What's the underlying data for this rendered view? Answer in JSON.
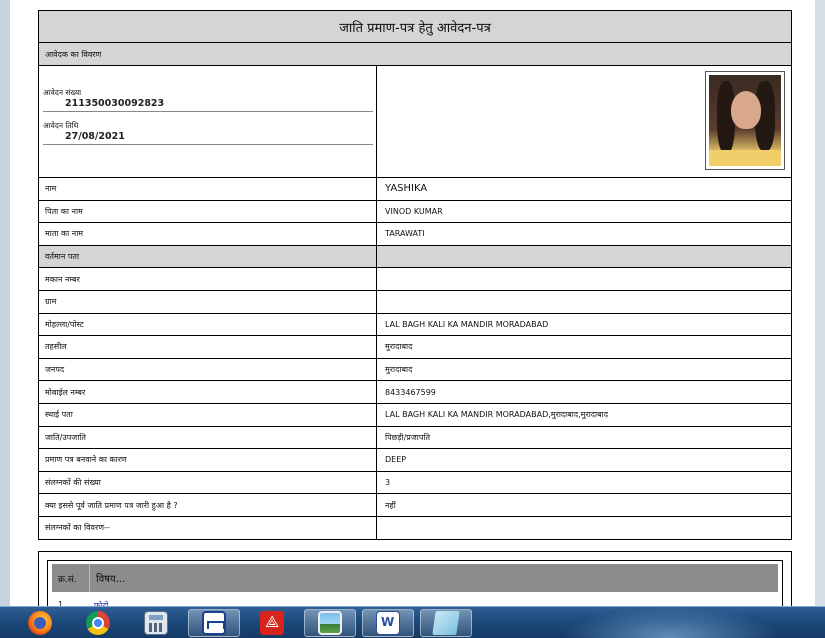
{
  "form": {
    "title": "जाति प्रमाण-पत्र हेतु आवेदन-पत्र",
    "applicant_section": "आवेदक का विवरण",
    "application_number_label": "आवेदन संख्या",
    "application_number": "211350030092823",
    "application_date_label": "आवेदन तिथि",
    "application_date": "27/08/2021",
    "rows": [
      {
        "label": "नाम",
        "value": "YASHIKA"
      },
      {
        "label": "पिता का नाम",
        "value": "VINOD KUMAR"
      },
      {
        "label": "माता का नाम",
        "value": "TARAWATI"
      },
      {
        "label": "वर्तमान पता",
        "value": ""
      },
      {
        "label": "मकान नम्बर",
        "value": ""
      },
      {
        "label": "ग्राम",
        "value": ""
      },
      {
        "label": "मोहल्ला/पोस्ट",
        "value": "LAL BAGH KALI KA MANDIR MORADABAD"
      },
      {
        "label": "तहसील",
        "value": "मुरादाबाद"
      },
      {
        "label": "जनपद",
        "value": "मुरादाबाद"
      },
      {
        "label": "मोबाईल नम्बर",
        "value": "8433467599"
      },
      {
        "label": "स्थाई पता",
        "value": "LAL BAGH KALI KA MANDIR MORADABAD,मुरादाबाद,मुरादाबाद"
      },
      {
        "label": "जाति/उपजाति",
        "value": "पिछड़ी/प्रजापति"
      },
      {
        "label": "प्रमाण पत्र बनवाने का कारण",
        "value": "DEEP"
      },
      {
        "label": "संलग्नकों की संख्या",
        "value": "3"
      },
      {
        "label": "क्या इससे पूर्व जाति प्रमाण पत्र जारी हुआ है ?",
        "value": "नहीं"
      },
      {
        "label": "संलग्नकों का विवरण--",
        "value": ""
      }
    ],
    "attachments": {
      "col_sno": "क्र.सं.",
      "col_subject": "विषय...",
      "first_sno": "1",
      "first_subject": "फोटो"
    }
  },
  "taskbar": {
    "apps": [
      "firefox-icon",
      "chrome-icon",
      "calculator-icon",
      "scanner-icon",
      "pdf-icon",
      "photo-viewer-icon",
      "word-icon",
      "sticky-notes-icon"
    ]
  }
}
